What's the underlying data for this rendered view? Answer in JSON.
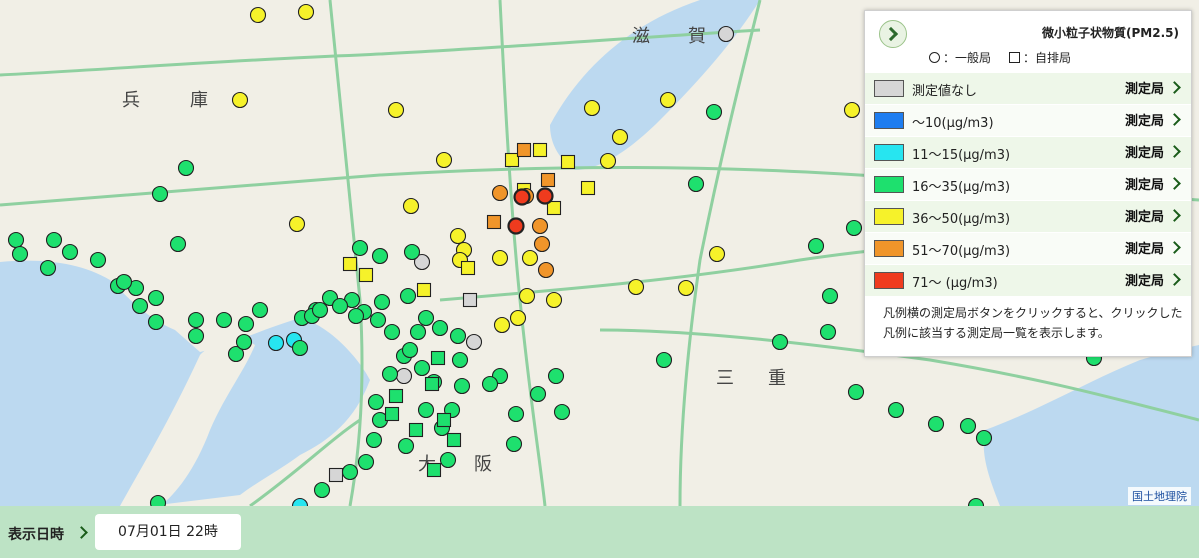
{
  "map": {
    "attribution": "国土地理院",
    "place_labels": [
      "兵",
      "庫",
      "滋",
      "賀",
      "大",
      "阪",
      "三",
      "重"
    ],
    "colors": {
      "none": "#d6d6d6",
      "c10": "#1e7df0",
      "c15": "#27e5f0",
      "c35": "#1ee06e",
      "c50": "#f6f22a",
      "c70": "#f0952a",
      "c71": "#ef3b1e"
    },
    "stations": [
      {
        "cls": "c50",
        "shape": "circle"
      },
      {
        "cls": "c50",
        "shape": "circle"
      },
      {
        "cls": "c50",
        "shape": "circle"
      },
      {
        "cls": "c50",
        "shape": "circle"
      },
      {
        "cls": "c50",
        "shape": "circle"
      },
      {
        "cls": "c50",
        "shape": "circle"
      },
      {
        "cls": "c50",
        "shape": "circle"
      },
      {
        "cls": "c50",
        "shape": "circle"
      },
      {
        "cls": "c50",
        "shape": "circle"
      },
      {
        "cls": "c50",
        "shape": "circle"
      },
      {
        "cls": "c50",
        "shape": "circle"
      },
      {
        "cls": "c50",
        "shape": "circle"
      },
      {
        "cls": "c50",
        "shape": "circle"
      },
      {
        "cls": "c50",
        "shape": "circle"
      },
      {
        "cls": "c50",
        "shape": "circle"
      },
      {
        "cls": "c50",
        "shape": "circle"
      },
      {
        "cls": "c50",
        "shape": "circle"
      },
      {
        "cls": "c50",
        "shape": "circle"
      },
      {
        "cls": "c50",
        "shape": "circle"
      },
      {
        "cls": "c50",
        "shape": "circle"
      },
      {
        "cls": "c50",
        "shape": "circle"
      },
      {
        "cls": "c50",
        "shape": "circle"
      },
      {
        "cls": "c50",
        "shape": "circle"
      },
      {
        "cls": "c50",
        "shape": "circle"
      },
      {
        "cls": "c50",
        "shape": "square"
      },
      {
        "cls": "c50",
        "shape": "square"
      },
      {
        "cls": "c50",
        "shape": "square"
      },
      {
        "cls": "c50",
        "shape": "square"
      },
      {
        "cls": "c50",
        "shape": "square"
      },
      {
        "cls": "c50",
        "shape": "square"
      },
      {
        "cls": "c50",
        "shape": "square"
      },
      {
        "cls": "c50",
        "shape": "square"
      },
      {
        "cls": "c50",
        "shape": "square"
      },
      {
        "cls": "c50",
        "shape": "square"
      },
      {
        "cls": "none",
        "shape": "circle"
      },
      {
        "cls": "none",
        "shape": "circle"
      },
      {
        "cls": "none",
        "shape": "circle"
      },
      {
        "cls": "none",
        "shape": "circle"
      },
      {
        "cls": "none",
        "shape": "square"
      },
      {
        "cls": "none",
        "shape": "square"
      },
      {
        "cls": "c70",
        "shape": "circle"
      },
      {
        "cls": "c70",
        "shape": "circle"
      },
      {
        "cls": "c70",
        "shape": "circle"
      },
      {
        "cls": "c70",
        "shape": "circle"
      },
      {
        "cls": "c70",
        "shape": "circle"
      },
      {
        "cls": "c70",
        "shape": "square"
      },
      {
        "cls": "c70",
        "shape": "square"
      },
      {
        "cls": "c70",
        "shape": "square"
      },
      {
        "cls": "c71",
        "shape": "circle"
      },
      {
        "cls": "c71",
        "shape": "circle"
      },
      {
        "cls": "c71",
        "shape": "circle"
      },
      {
        "cls": "c15",
        "shape": "circle"
      },
      {
        "cls": "c15",
        "shape": "circle"
      },
      {
        "cls": "c15",
        "shape": "circle"
      },
      {
        "cls": "c35",
        "shape": "circle"
      },
      {
        "cls": "c35",
        "shape": "circle"
      },
      {
        "cls": "c35",
        "shape": "circle"
      },
      {
        "cls": "c35",
        "shape": "circle"
      },
      {
        "cls": "c35",
        "shape": "circle"
      },
      {
        "cls": "c35",
        "shape": "circle"
      },
      {
        "cls": "c35",
        "shape": "circle"
      },
      {
        "cls": "c35",
        "shape": "circle"
      },
      {
        "cls": "c35",
        "shape": "circle"
      },
      {
        "cls": "c35",
        "shape": "circle"
      },
      {
        "cls": "c35",
        "shape": "circle"
      },
      {
        "cls": "c35",
        "shape": "circle"
      },
      {
        "cls": "c35",
        "shape": "circle"
      },
      {
        "cls": "c35",
        "shape": "circle"
      },
      {
        "cls": "c35",
        "shape": "circle"
      },
      {
        "cls": "c35",
        "shape": "circle"
      },
      {
        "cls": "c35",
        "shape": "circle"
      },
      {
        "cls": "c35",
        "shape": "circle"
      },
      {
        "cls": "c35",
        "shape": "circle"
      },
      {
        "cls": "c35",
        "shape": "circle"
      },
      {
        "cls": "c35",
        "shape": "circle"
      },
      {
        "cls": "c35",
        "shape": "circle"
      },
      {
        "cls": "c35",
        "shape": "circle"
      },
      {
        "cls": "c35",
        "shape": "circle"
      },
      {
        "cls": "c35",
        "shape": "circle"
      },
      {
        "cls": "c35",
        "shape": "circle"
      },
      {
        "cls": "c35",
        "shape": "circle"
      },
      {
        "cls": "c35",
        "shape": "circle"
      },
      {
        "cls": "c35",
        "shape": "circle"
      },
      {
        "cls": "c35",
        "shape": "circle"
      },
      {
        "cls": "c35",
        "shape": "circle"
      },
      {
        "cls": "c35",
        "shape": "circle"
      },
      {
        "cls": "c35",
        "shape": "circle"
      },
      {
        "cls": "c35",
        "shape": "circle"
      },
      {
        "cls": "c35",
        "shape": "circle"
      },
      {
        "cls": "c35",
        "shape": "circle"
      },
      {
        "cls": "c35",
        "shape": "circle"
      },
      {
        "cls": "c35",
        "shape": "circle"
      },
      {
        "cls": "c35",
        "shape": "circle"
      },
      {
        "cls": "c35",
        "shape": "circle"
      },
      {
        "cls": "c35",
        "shape": "circle"
      },
      {
        "cls": "c35",
        "shape": "circle"
      },
      {
        "cls": "c35",
        "shape": "circle"
      },
      {
        "cls": "c35",
        "shape": "circle"
      },
      {
        "cls": "c35",
        "shape": "circle"
      },
      {
        "cls": "c35",
        "shape": "circle"
      },
      {
        "cls": "c35",
        "shape": "circle"
      },
      {
        "cls": "c35",
        "shape": "circle"
      },
      {
        "cls": "c35",
        "shape": "circle"
      },
      {
        "cls": "c35",
        "shape": "circle"
      },
      {
        "cls": "c35",
        "shape": "circle"
      },
      {
        "cls": "c35",
        "shape": "circle"
      },
      {
        "cls": "c35",
        "shape": "circle"
      },
      {
        "cls": "c35",
        "shape": "circle"
      },
      {
        "cls": "c35",
        "shape": "circle"
      },
      {
        "cls": "c35",
        "shape": "circle"
      },
      {
        "cls": "c35",
        "shape": "circle"
      },
      {
        "cls": "c35",
        "shape": "circle"
      },
      {
        "cls": "c35",
        "shape": "circle"
      },
      {
        "cls": "c35",
        "shape": "circle"
      },
      {
        "cls": "c35",
        "shape": "circle"
      },
      {
        "cls": "c35",
        "shape": "circle"
      },
      {
        "cls": "c35",
        "shape": "circle"
      },
      {
        "cls": "c35",
        "shape": "circle"
      },
      {
        "cls": "c35",
        "shape": "circle"
      },
      {
        "cls": "c35",
        "shape": "circle"
      },
      {
        "cls": "c35",
        "shape": "circle"
      },
      {
        "cls": "c35",
        "shape": "circle"
      },
      {
        "cls": "c35",
        "shape": "circle"
      },
      {
        "cls": "c35",
        "shape": "circle"
      },
      {
        "cls": "c35",
        "shape": "circle"
      },
      {
        "cls": "c35",
        "shape": "circle"
      },
      {
        "cls": "c35",
        "shape": "circle"
      },
      {
        "cls": "c35",
        "shape": "circle"
      },
      {
        "cls": "c35",
        "shape": "circle"
      },
      {
        "cls": "c35",
        "shape": "circle"
      },
      {
        "cls": "c35",
        "shape": "circle"
      },
      {
        "cls": "c35",
        "shape": "circle"
      },
      {
        "cls": "c35",
        "shape": "circle"
      },
      {
        "cls": "c35",
        "shape": "circle"
      },
      {
        "cls": "c35",
        "shape": "circle"
      },
      {
        "cls": "c35",
        "shape": "circle"
      },
      {
        "cls": "c35",
        "shape": "circle"
      },
      {
        "cls": "c35",
        "shape": "circle"
      },
      {
        "cls": "c35",
        "shape": "square"
      },
      {
        "cls": "c35",
        "shape": "square"
      },
      {
        "cls": "c35",
        "shape": "square"
      },
      {
        "cls": "c35",
        "shape": "square"
      },
      {
        "cls": "c35",
        "shape": "square"
      },
      {
        "cls": "c35",
        "shape": "square"
      },
      {
        "cls": "c35",
        "shape": "square"
      },
      {
        "cls": "c35",
        "shape": "square"
      },
      {
        "cls": "c35",
        "shape": "square"
      },
      {
        "cls": "c35",
        "shape": "square"
      },
      {
        "cls": "c35",
        "shape": "square"
      },
      {
        "cls": "c35",
        "shape": "square"
      },
      {
        "cls": "c35",
        "shape": "square"
      },
      {
        "cls": "c35",
        "shape": "square"
      },
      {
        "cls": "c35",
        "shape": "square"
      },
      {
        "cls": "c35",
        "shape": "square"
      },
      {
        "cls": "c35",
        "shape": "square"
      },
      {
        "cls": "c35",
        "shape": "square"
      },
      {
        "cls": "c35",
        "shape": "square"
      },
      {
        "cls": "c35",
        "shape": "square"
      },
      {
        "cls": "c35",
        "shape": "square"
      },
      {
        "cls": "c35",
        "shape": "square"
      }
    ]
  },
  "legend": {
    "title": "微小粒子状物質(PM2.5)",
    "type_general": "：一般局",
    "type_roadside": "：自排局",
    "rows": [
      {
        "label": "測定値なし",
        "color": "#d6d6d6",
        "button": "測定局"
      },
      {
        "label": "〜10(μg/m3)",
        "color": "#1e7df0",
        "button": "測定局"
      },
      {
        "label": "11〜15(μg/m3)",
        "color": "#27e5f0",
        "button": "測定局"
      },
      {
        "label": "16〜35(μg/m3)",
        "color": "#1ee06e",
        "button": "測定局"
      },
      {
        "label": "36〜50(μg/m3)",
        "color": "#f6f22a",
        "button": "測定局"
      },
      {
        "label": "51〜70(μg/m3)",
        "color": "#f0952a",
        "button": "測定局"
      },
      {
        "label": "71〜 (μg/m3)",
        "color": "#ef3b1e",
        "button": "測定局"
      }
    ],
    "note": "凡例横の測定局ボタンをクリックすると、クリックした凡例に該当する測定局一覧を表示します。"
  },
  "footer": {
    "date_label": "表示日時",
    "date_value": "07月01日 22時"
  }
}
